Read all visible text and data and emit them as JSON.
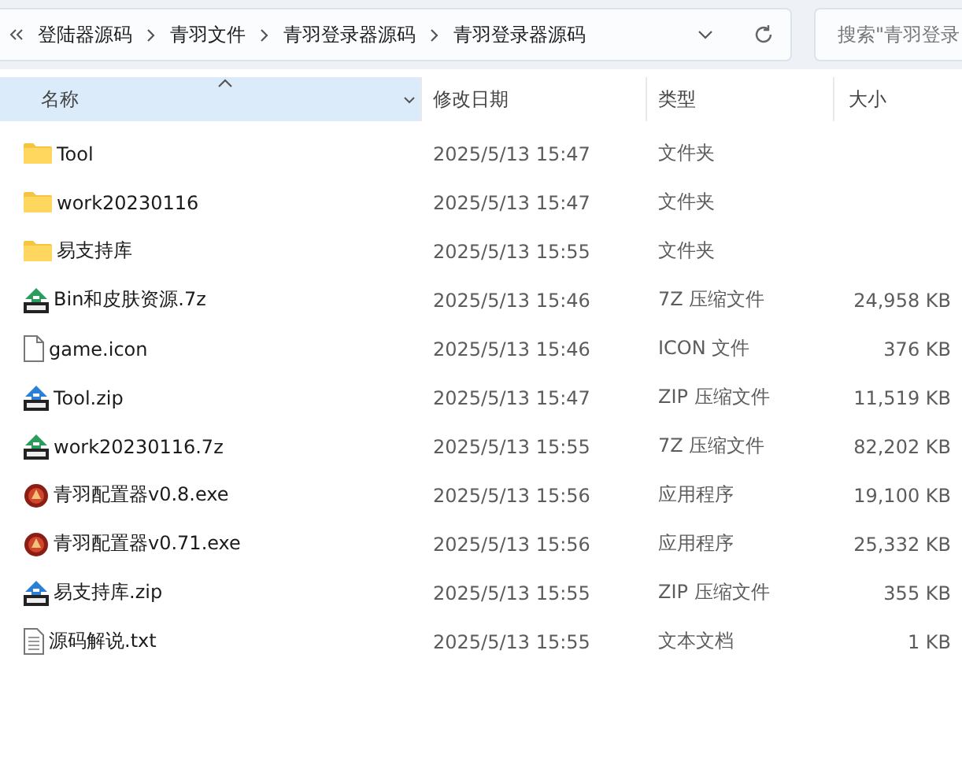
{
  "address_bar": {
    "breadcrumbs": [
      "登陆器源码",
      "青羽文件",
      "青羽登录器源码",
      "青羽登录器源码"
    ]
  },
  "search": {
    "placeholder": "搜索\"青羽登录"
  },
  "columns": [
    {
      "label": "名称",
      "sorted": true
    },
    {
      "label": "修改日期",
      "sorted": false
    },
    {
      "label": "类型",
      "sorted": false
    },
    {
      "label": "大小",
      "sorted": false
    }
  ],
  "rows": [
    {
      "kind": "folder",
      "name": "Tool",
      "date": "2025/5/13 15:47",
      "type": "文件夹"
    },
    {
      "kind": "folder",
      "name": "work20230116",
      "date": "2025/5/13 15:47",
      "type": "文件夹"
    },
    {
      "kind": "folder",
      "name": "易支持库",
      "date": "2025/5/13 15:55",
      "type": "文件夹"
    },
    {
      "kind": "archive7z",
      "name": "Bin和皮肤资源.7z",
      "date": "2025/5/13 15:46",
      "type": "7Z 压缩文件",
      "size": "24,958 KB"
    },
    {
      "kind": "file",
      "name": "game.icon",
      "date": "2025/5/13 15:46",
      "type": "ICON 文件",
      "size": "376 KB"
    },
    {
      "kind": "archivezip",
      "name": "Tool.zip",
      "date": "2025/5/13 15:47",
      "type": "ZIP 压缩文件",
      "size": "11,519 KB"
    },
    {
      "kind": "archive7z",
      "name": "work20230116.7z",
      "date": "2025/5/13 15:55",
      "type": "7Z 压缩文件",
      "size": "82,202 KB"
    },
    {
      "kind": "exe",
      "name": "青羽配置器v0.8.exe",
      "date": "2025/5/13 15:56",
      "type": "应用程序",
      "size": "19,100 KB"
    },
    {
      "kind": "exe",
      "name": "青羽配置器v0.71.exe",
      "date": "2025/5/13 15:56",
      "type": "应用程序",
      "size": "25,332 KB"
    },
    {
      "kind": "archivezip",
      "name": "易支持库.zip",
      "date": "2025/5/13 15:55",
      "type": "ZIP 压缩文件",
      "size": "355 KB"
    },
    {
      "kind": "text",
      "name": "源码解说.txt",
      "date": "2025/5/13 15:55",
      "type": "文本文档",
      "size": "1 KB"
    }
  ]
}
